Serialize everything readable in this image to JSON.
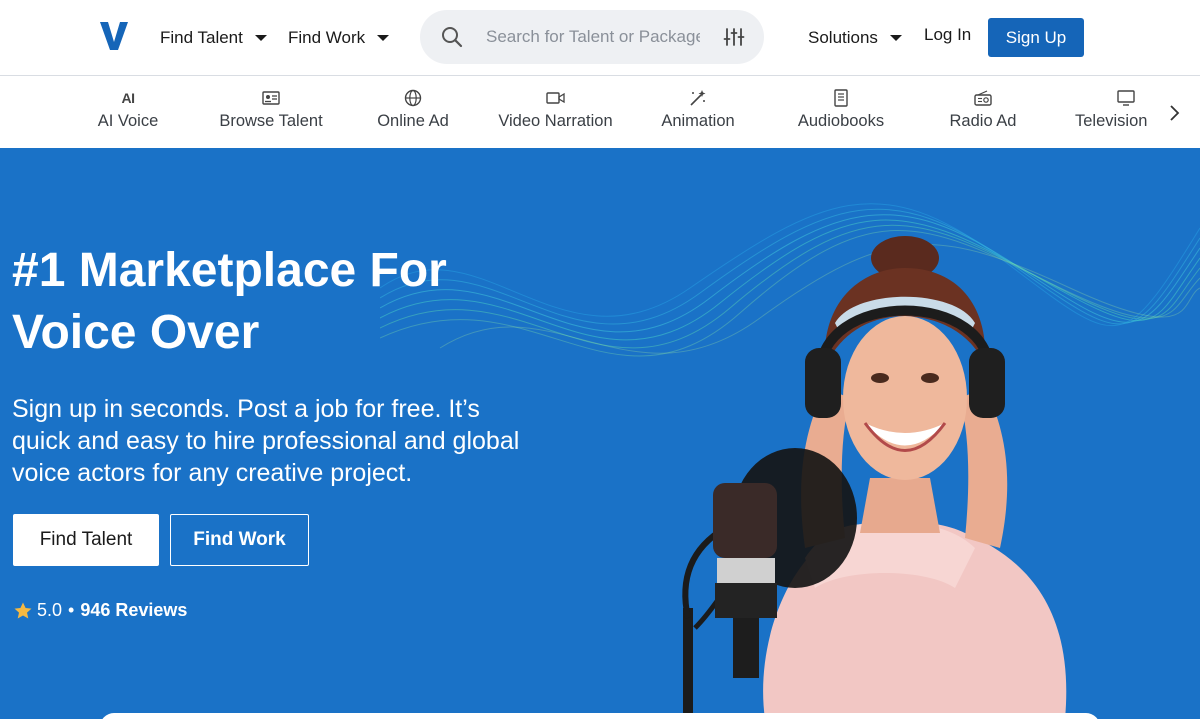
{
  "header": {
    "logo_text": "V",
    "find_talent": "Find Talent",
    "find_work": "Find Work",
    "search_placeholder": "Search for Talent or Packages",
    "solutions": "Solutions",
    "login": "Log In",
    "signup": "Sign Up"
  },
  "categories": [
    {
      "label": "AI Voice",
      "icon": "ai-icon"
    },
    {
      "label": "Browse Talent",
      "icon": "id-card-icon"
    },
    {
      "label": "Online Ad",
      "icon": "globe-icon"
    },
    {
      "label": "Video Narration",
      "icon": "video-camera-icon"
    },
    {
      "label": "Animation",
      "icon": "magic-wand-icon"
    },
    {
      "label": "Audiobooks",
      "icon": "book-icon"
    },
    {
      "label": "Radio Ad",
      "icon": "radio-icon"
    },
    {
      "label": "Television",
      "icon": "tv-icon"
    }
  ],
  "hero": {
    "title_line1": "#1 Marketplace For",
    "title_line2": "Voice Over",
    "subtitle": "Sign up in seconds. Post a job for free. It’s quick and easy to hire professional and global voice actors for any creative project.",
    "find_talent_btn": "Find Talent",
    "find_work_btn": "Find Work",
    "rating_value": "5.0",
    "rating_sep": "•",
    "reviews": "946 Reviews"
  },
  "colors": {
    "brand": "#1565b8",
    "hero_bg": "#1a72c7",
    "accent_star": "#f5b942"
  }
}
